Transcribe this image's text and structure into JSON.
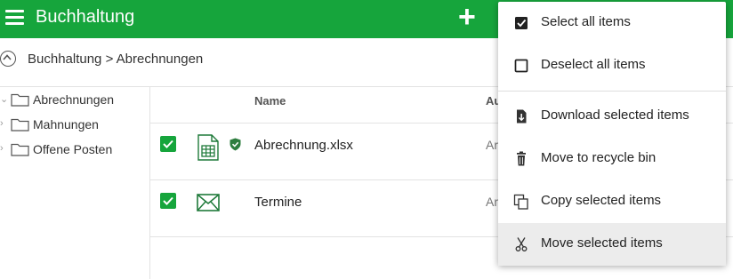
{
  "header": {
    "title": "Buchhaltung",
    "menu_icon": "hamburger-icon",
    "add_icon": "plus-icon",
    "add_glyph": "+",
    "accent_color": "#16a53c"
  },
  "breadcrumb": {
    "path": "Buchhaltung > Abrechnungen",
    "collapse_icon": "chevron-up-circle-icon"
  },
  "sidebar": {
    "items": [
      {
        "label": "Abrechnungen",
        "icon": "folder-icon"
      },
      {
        "label": "Mahnungen",
        "icon": "folder-icon"
      },
      {
        "label": "Offene Posten",
        "icon": "folder-icon"
      }
    ]
  },
  "table": {
    "columns": {
      "name": "Name",
      "author": "Au"
    },
    "rows": [
      {
        "name": "Abrechnung.xlsx",
        "author": "Ar",
        "checked": true,
        "icon": "spreadsheet-icon",
        "protected_icon": "shield-check-icon"
      },
      {
        "name": "Termine",
        "author": "Ar",
        "checked": true,
        "icon": "mail-icon"
      }
    ]
  },
  "context_menu": {
    "items": [
      {
        "label": "Select all items",
        "icon": "checkbox-checked-icon"
      },
      {
        "label": "Deselect all items",
        "icon": "checkbox-empty-icon"
      },
      {
        "label": "Download selected items",
        "icon": "download-icon"
      },
      {
        "label": "Move to recycle bin",
        "icon": "trash-icon"
      },
      {
        "label": "Copy selected items",
        "icon": "copy-icon"
      },
      {
        "label": "Move selected items",
        "icon": "scissors-icon",
        "hovered": true
      }
    ]
  }
}
